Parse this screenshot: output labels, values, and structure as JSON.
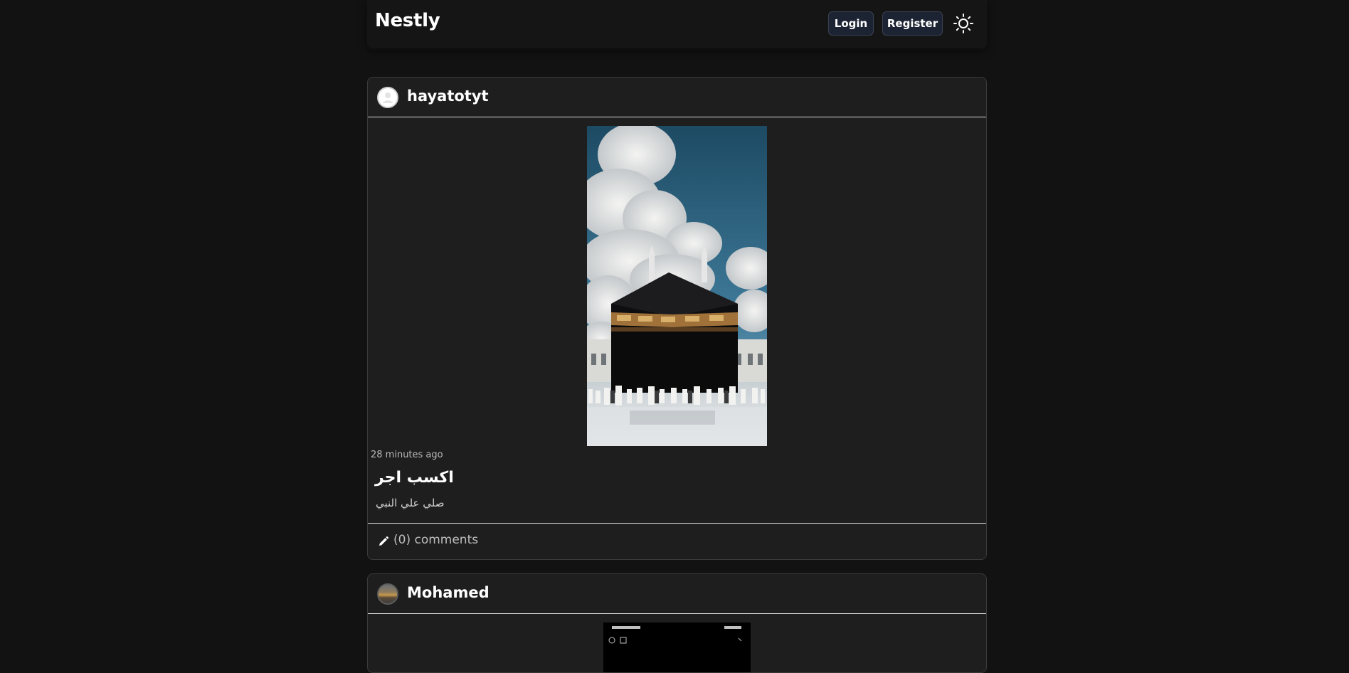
{
  "navbar": {
    "brand": "Nestly",
    "login_label": "Login",
    "register_label": "Register",
    "theme_icon": "sun-icon"
  },
  "posts": [
    {
      "username": "hayatotyt",
      "avatar": "default-user-avatar",
      "image": "kaaba-photo",
      "timestamp": "28 minutes ago",
      "title": "اكسب اجر",
      "body": "صلي علي النبي",
      "comments_label": "(0) comments",
      "comments_icon": "pencil-icon"
    },
    {
      "username": "Mohamed",
      "avatar": "user-photo-avatar",
      "image": "phone-screenshot"
    }
  ]
}
